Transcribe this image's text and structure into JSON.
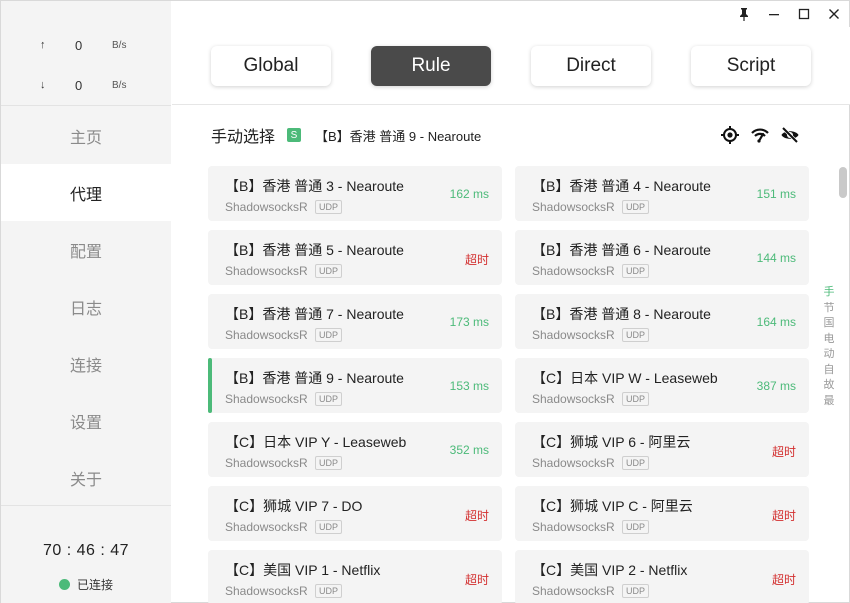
{
  "window_controls": {
    "pin_icon": "pin-icon",
    "minimize": "─",
    "maximize": "☐",
    "close": "✕"
  },
  "traffic": {
    "up_arrow": "↑",
    "up_value": "0",
    "up_unit": "B/s",
    "down_arrow": "↓",
    "down_value": "0",
    "down_unit": "B/s"
  },
  "nav": [
    {
      "label": "主页",
      "active": false
    },
    {
      "label": "代理",
      "active": true
    },
    {
      "label": "配置",
      "active": false
    },
    {
      "label": "日志",
      "active": false
    },
    {
      "label": "连接",
      "active": false
    },
    {
      "label": "设置",
      "active": false
    },
    {
      "label": "关于",
      "active": false
    }
  ],
  "timer": "70 : 46 : 47",
  "status_text": "已连接",
  "modes": [
    {
      "label": "Global",
      "active": false
    },
    {
      "label": "Rule",
      "active": true
    },
    {
      "label": "Direct",
      "active": false
    },
    {
      "label": "Script",
      "active": false
    }
  ],
  "group": {
    "name": "手动选择",
    "badge": "S",
    "selected": "【B】香港 普通 9 - Nearoute",
    "icons": [
      "locate-icon",
      "wifi-speed-icon",
      "eye-slash-icon"
    ]
  },
  "proxies": [
    {
      "name": "【B】香港 普通 3 - Nearoute",
      "type": "ShadowsocksR",
      "udp": "UDP",
      "delay": "162 ms",
      "ok": true,
      "selected": false
    },
    {
      "name": "【B】香港 普通 4 - Nearoute",
      "type": "ShadowsocksR",
      "udp": "UDP",
      "delay": "151 ms",
      "ok": true,
      "selected": false
    },
    {
      "name": "【B】香港 普通 5 - Nearoute",
      "type": "ShadowsocksR",
      "udp": "UDP",
      "delay": "超时",
      "ok": false,
      "selected": false
    },
    {
      "name": "【B】香港 普通 6 - Nearoute",
      "type": "ShadowsocksR",
      "udp": "UDP",
      "delay": "144 ms",
      "ok": true,
      "selected": false
    },
    {
      "name": "【B】香港 普通 7 - Nearoute",
      "type": "ShadowsocksR",
      "udp": "UDP",
      "delay": "173 ms",
      "ok": true,
      "selected": false
    },
    {
      "name": "【B】香港 普通 8 - Nearoute",
      "type": "ShadowsocksR",
      "udp": "UDP",
      "delay": "164 ms",
      "ok": true,
      "selected": false
    },
    {
      "name": "【B】香港 普通 9 - Nearoute",
      "type": "ShadowsocksR",
      "udp": "UDP",
      "delay": "153 ms",
      "ok": true,
      "selected": true
    },
    {
      "name": "【C】日本 VIP W - Leaseweb",
      "type": "ShadowsocksR",
      "udp": "UDP",
      "delay": "387 ms",
      "ok": true,
      "selected": false
    },
    {
      "name": "【C】日本 VIP Y - Leaseweb",
      "type": "ShadowsocksR",
      "udp": "UDP",
      "delay": "352 ms",
      "ok": true,
      "selected": false
    },
    {
      "name": "【C】狮城 VIP 6 - 阿里云",
      "type": "ShadowsocksR",
      "udp": "UDP",
      "delay": "超时",
      "ok": false,
      "selected": false
    },
    {
      "name": "【C】狮城 VIP 7 - DO",
      "type": "ShadowsocksR",
      "udp": "UDP",
      "delay": "超时",
      "ok": false,
      "selected": false
    },
    {
      "name": "【C】狮城 VIP C - 阿里云",
      "type": "ShadowsocksR",
      "udp": "UDP",
      "delay": "超时",
      "ok": false,
      "selected": false
    },
    {
      "name": "【C】美国 VIP 1 - Netflix",
      "type": "ShadowsocksR",
      "udp": "UDP",
      "delay": "超时",
      "ok": false,
      "selected": false
    },
    {
      "name": "【C】美国 VIP 2 - Netflix",
      "type": "ShadowsocksR",
      "udp": "UDP",
      "delay": "超时",
      "ok": false,
      "selected": false
    }
  ],
  "side_index": [
    "手",
    "节",
    "国",
    "电",
    "动",
    "自",
    "故",
    "最"
  ],
  "colors": {
    "accent": "#4cba79",
    "timeout": "#d32f2f",
    "active_mode": "#4a4a4a"
  }
}
